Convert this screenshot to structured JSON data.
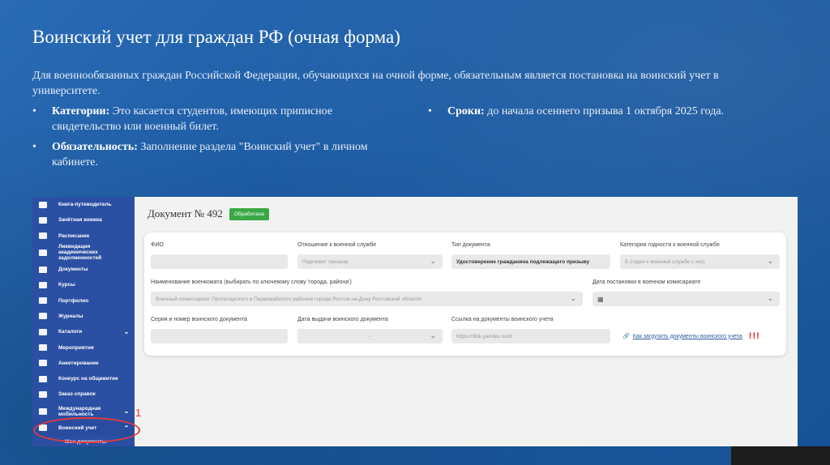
{
  "slide": {
    "title": "Воинский учет для граждан РФ (очная форма)",
    "intro": "Для военнообязанных граждан Российской Федерации, обучающихся на очной форме, обязательным является постановка на воинский учет в университете.",
    "bullets_left": [
      {
        "label": "Категории:",
        "text": " Это касается студентов, имеющих приписное свидетельство или военный билет."
      },
      {
        "label": "Обязательность:",
        "text": " Заполнение раздела \"Воинский учет\" в личном кабинете."
      }
    ],
    "bullets_right": [
      {
        "label": "Сроки:",
        "text": " до начала осеннего призыва 1 октября 2025 года."
      }
    ],
    "bullet_char": "•",
    "marker_number": "1"
  },
  "sidebar": {
    "items": [
      {
        "label": "Книга-путеводитель",
        "icon": "book-guide-icon"
      },
      {
        "label": "Зачётная книжка",
        "icon": "graduation-cap-icon"
      },
      {
        "label": "Расписание",
        "icon": "calendar-icon"
      },
      {
        "label": "Ликвидация академических задолженностей",
        "icon": "document-icon"
      },
      {
        "label": "Документы",
        "icon": "folder-icon"
      },
      {
        "label": "Курсы",
        "icon": "courses-icon"
      },
      {
        "label": "Портфолио",
        "icon": "trophy-icon"
      },
      {
        "label": "Журналы",
        "icon": "journal-icon"
      },
      {
        "label": "Каталоги",
        "icon": "catalog-icon",
        "chevron": "⌄"
      },
      {
        "label": "Мероприятия",
        "icon": "event-icon"
      },
      {
        "label": "Анкетирование",
        "icon": "survey-icon"
      },
      {
        "label": "Конкурс на общежитие",
        "icon": "flag-icon"
      },
      {
        "label": "Заказ справок",
        "icon": "certificate-icon"
      },
      {
        "label": "Международная мобильность",
        "icon": "globe-icon",
        "chevron": "⌄"
      },
      {
        "label": "Воинский учет",
        "icon": "military-icon",
        "chevron": "⌃"
      }
    ],
    "sub_item": "Мои документы"
  },
  "document": {
    "title": "Документ № 492",
    "status": "Обработана"
  },
  "form": {
    "fio": {
      "label": "ФИО",
      "value": ""
    },
    "relation": {
      "label": "Отношение к военной службе",
      "value": "Подлежит призыву"
    },
    "doc_type": {
      "label": "Тип документа",
      "value": "Удостоверение гражданина подлежащего призыву"
    },
    "category": {
      "label": "Категория годности к военной службе",
      "value": "Б (годен к военной службе с н/о)"
    },
    "commissariat": {
      "label": "Наименование военкомата (выбирать по ключевому слову 'города, района')",
      "value": "Военный комиссариат Пролетарского и Первомайского районов города Ростов-на-Дону Ростовской области"
    },
    "reg_date": {
      "label": "Дата постановки в военном комисариате",
      "value": ""
    },
    "series": {
      "label": "Серия и номер воинского документа",
      "value": ""
    },
    "issue_date": {
      "label": "Дата выдачи воинского документа",
      "value": "-"
    },
    "link": {
      "label": "Ссылка на документы воинского учета",
      "placeholder": "https://disk.yandex.ru/d/"
    },
    "help_link": "Как загрузить документы воинского учета",
    "exclaim": "!!!"
  }
}
